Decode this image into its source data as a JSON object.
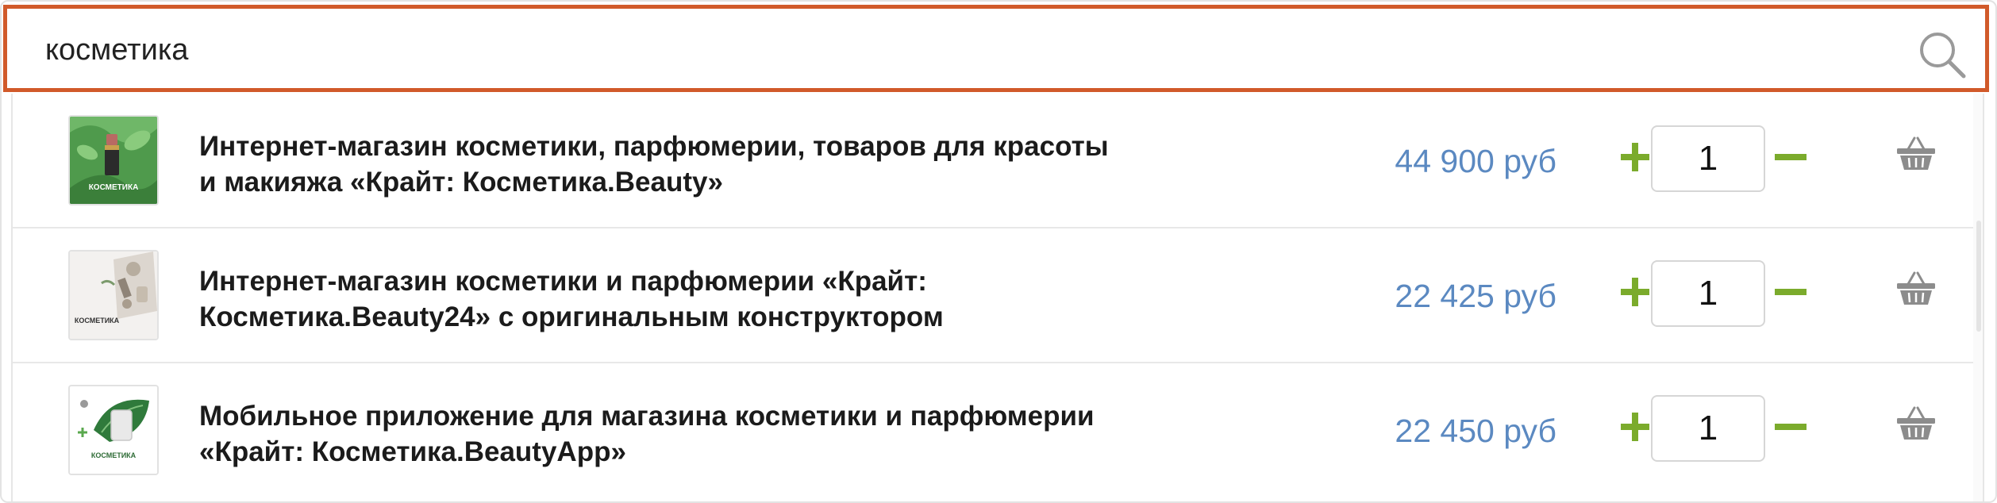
{
  "search": {
    "value": "косметика",
    "accent_color": "#d15a2a"
  },
  "price_color": "#5b89c1",
  "control_color": "#7bab2c",
  "results": [
    {
      "thumb_label": "КОСМЕТИКА",
      "title_line1": "Интернет-магазин косметики, парфюмерии, товаров для красоты",
      "title_line2": "и макияжа «Крайт: Косметика.Beauty»",
      "price": "44 900 руб",
      "quantity": "1"
    },
    {
      "thumb_label": "КОСМЕТИКА",
      "title_line1": "Интернет-магазин косметики и парфюмерии «Крайт:",
      "title_line2": "Косметика.Beauty24» с оригинальным конструктором",
      "price": "22 425 руб",
      "quantity": "1"
    },
    {
      "thumb_label": "КОСМЕТИКА",
      "title_line1": "Мобильное приложение для магазина косметики и парфюмерии",
      "title_line2": "«Крайт: Косметика.BeautyApp»",
      "price": "22 450 руб",
      "quantity": "1"
    }
  ]
}
